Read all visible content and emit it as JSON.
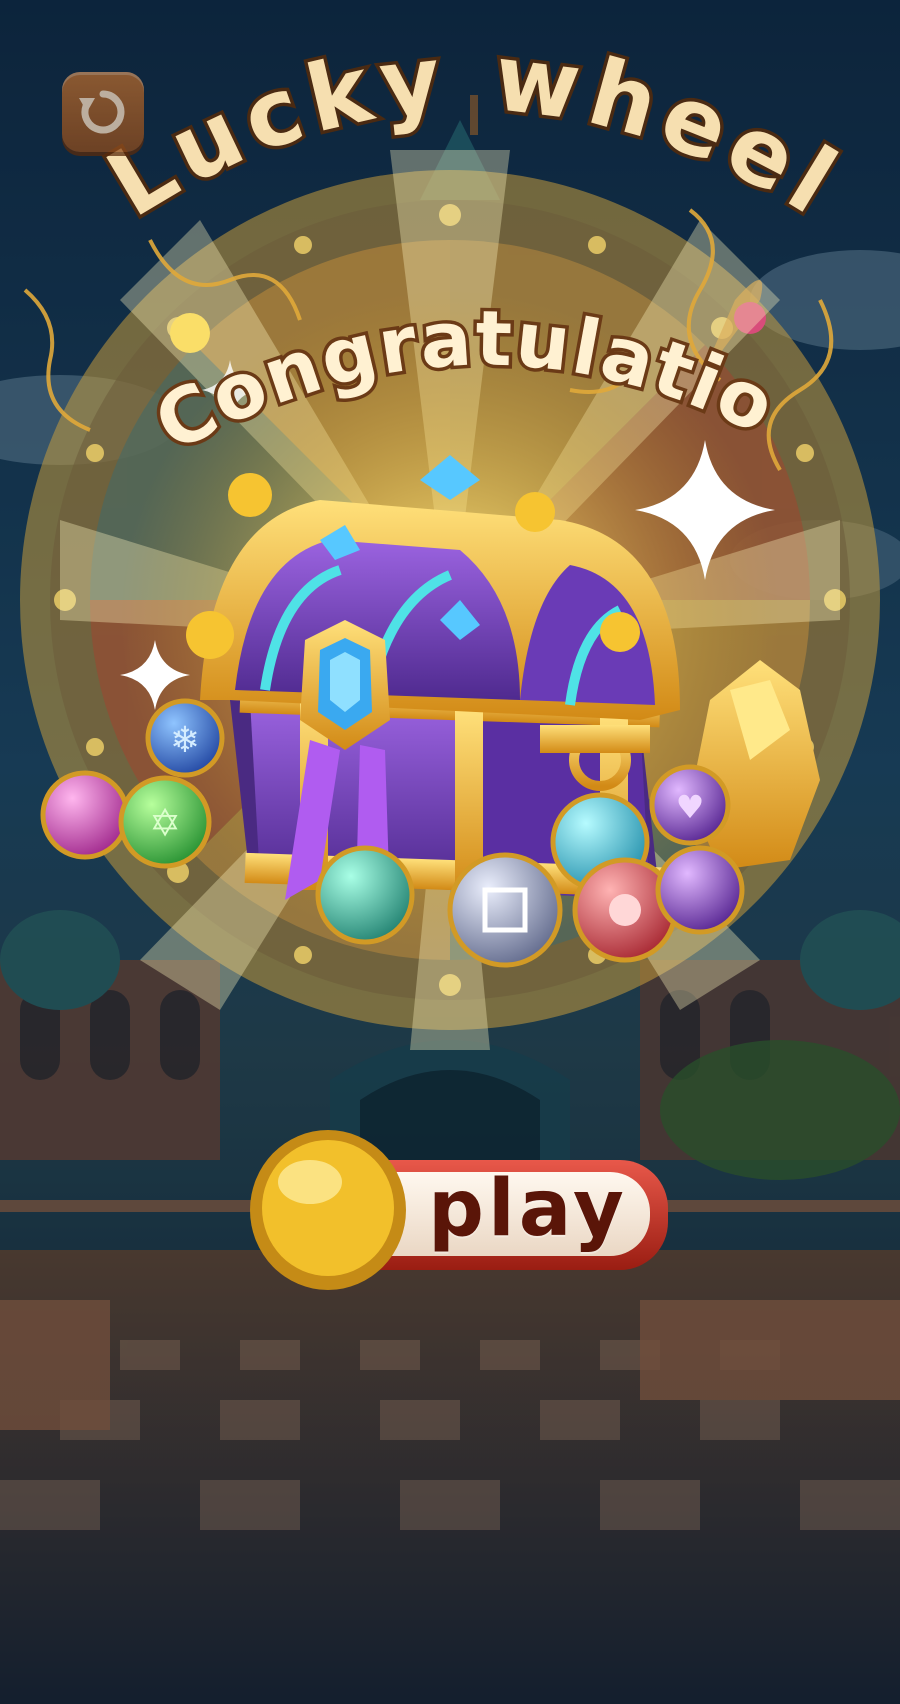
{
  "screen": {
    "title": "Lucky wheel",
    "message": "Congratulatio",
    "reward_icon": "treasure-chest-icon",
    "gem_icons": [
      "pink-feather-gem-icon",
      "green-star-gem-icon",
      "blue-snowflake-gem-icon",
      "teal-wind-gem-icon",
      "silver-rune-gem-icon",
      "cyan-gem-icon",
      "red-fist-gem-icon",
      "purple-leaf-gem-icon",
      "purple-heart-gem-icon"
    ],
    "back_icon": "back-arrow-icon"
  },
  "buttons": {
    "play_label": "play"
  },
  "colors": {
    "title_fill": "#f6dfb0",
    "title_stroke": "#4a2a12",
    "gold": "#f2b928",
    "chest_purple": "#7a3fc2",
    "play_red": "#c0301f"
  }
}
